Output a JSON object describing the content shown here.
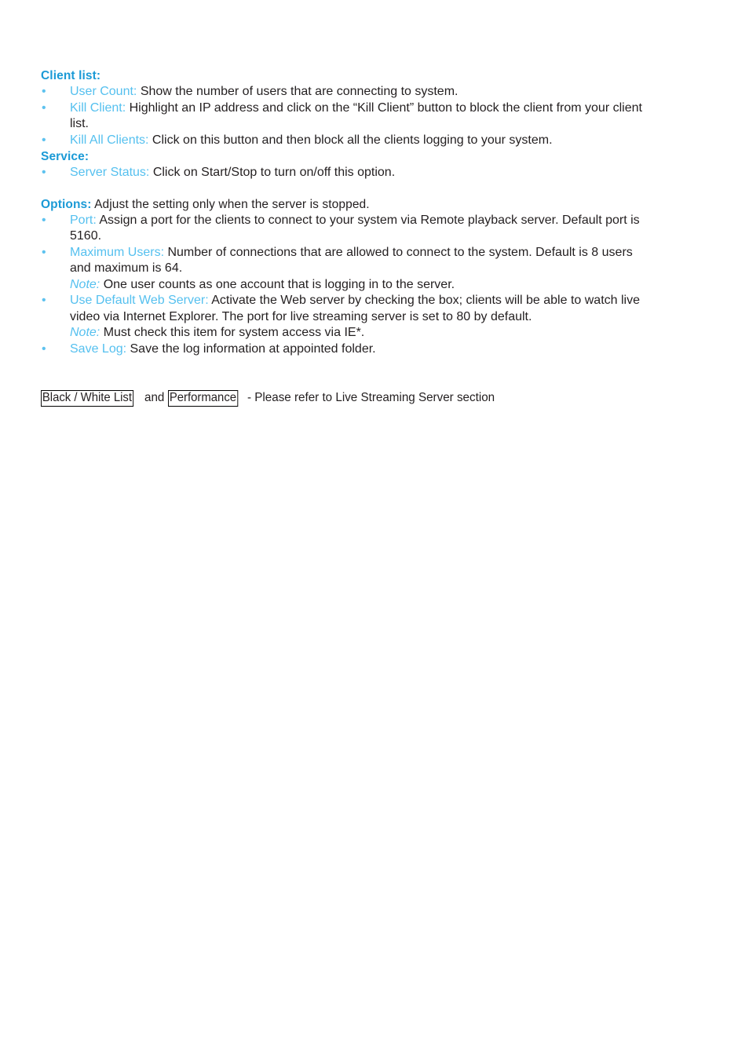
{
  "document": {
    "sections": [
      {
        "id": "client-list",
        "heading": "Client list:",
        "heading_tail": "",
        "items": [
          {
            "term": "User Count:",
            "text": " Show the number of users that are connecting to system."
          },
          {
            "term": "Kill Client:",
            "text": " Highlight an IP address and click on the “Kill Client” button to block the client from your client",
            "continuation": "list."
          },
          {
            "term": "Kill All Clients:",
            "text": " Click on this button and then block all the clients logging to your system."
          }
        ]
      },
      {
        "id": "service",
        "heading": "Service:",
        "heading_tail": "",
        "items": [
          {
            "term": "Server Status:",
            "text": " Click on Start/Stop to turn on/off this option."
          }
        ]
      },
      {
        "id": "options",
        "heading": "Options:",
        "heading_tail": " Adjust the setting only when the server is stopped.",
        "items": [
          {
            "term": "Port:",
            "text": " Assign a port for the clients to connect to your system via Remote playback server. Default port is",
            "continuation": "5160."
          },
          {
            "term": "Maximum Users:",
            "text": " Number of connections that are allowed to connect to the system. Default is 8 users",
            "continuation": "and maximum is 64.",
            "note_term": "Note:",
            "note_text": " One user counts as one account that is logging in to the server."
          },
          {
            "term": "Use Default Web Server:",
            "text": " Activate the Web server by checking the box; clients will be able to watch live",
            "continuation": "video via Internet Explorer. The port for live streaming server is set to 80 by default.",
            "note_term": "Note:",
            "note_text": " Must check this item for system access via IE*."
          },
          {
            "term": "Save Log:",
            "text": " Save the log information at appointed folder."
          }
        ]
      }
    ],
    "footer": {
      "box1": "Black / White List",
      "between": "and",
      "box2": "Performance",
      "tail": "- Please refer to Live Streaming Server section"
    },
    "bullet_glyph": "•",
    "colors": {
      "heading_blue": "#1b9ad6",
      "term_blue": "#55c0ef",
      "body_black": "#231f20",
      "page_background": "#ffffff",
      "box_border": "#000000"
    }
  }
}
